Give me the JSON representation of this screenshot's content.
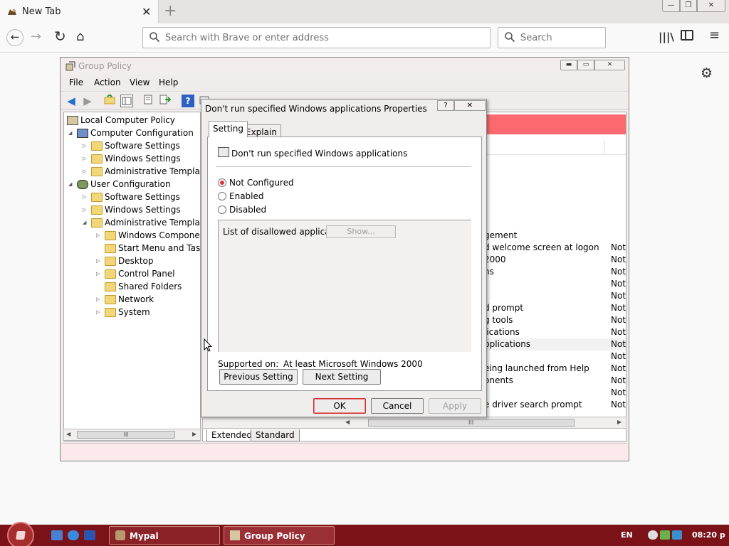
{
  "browser": {
    "tab_title": "New Tab",
    "tab_close": "✕",
    "new_tab": "+",
    "window_buttons": {
      "minimize": "—",
      "maximize": "❐",
      "close": "✕"
    },
    "nav": {
      "back": "←",
      "forward": "→",
      "reload": "↻",
      "home": "⌂"
    },
    "urlbar_placeholder": "Search with Brave or enter address",
    "searchbar_placeholder": "Search",
    "toolbar": {
      "library": "|||\\",
      "menu": "≡",
      "gear": "⚙"
    }
  },
  "gp_window": {
    "title": "Group Policy",
    "window_buttons": {
      "minimize": "▬",
      "maximize": "▭",
      "close": "✕"
    },
    "menu": [
      "File",
      "Action",
      "View",
      "Help"
    ],
    "toolbar_icons": [
      "back-icon",
      "forward-icon",
      "up-folder-icon",
      "show-hide-tree-icon",
      "properties-icon",
      "export-list-icon",
      "help-icon",
      "console-icon"
    ],
    "tree": [
      {
        "label": "Local Computer Policy",
        "level": 0,
        "expander": "",
        "icon": "policy-icon"
      },
      {
        "label": "Computer Configuration",
        "level": 1,
        "expander": "◢",
        "icon": "computer-icon"
      },
      {
        "label": "Software Settings",
        "level": 2,
        "expander": "▷",
        "icon": "folder-icon"
      },
      {
        "label": "Windows Settings",
        "level": 2,
        "expander": "▷",
        "icon": "folder-icon"
      },
      {
        "label": "Administrative Templates",
        "level": 2,
        "expander": "▷",
        "icon": "folder-icon"
      },
      {
        "label": "User Configuration",
        "level": 1,
        "expander": "◢",
        "icon": "user-icon"
      },
      {
        "label": "Software Settings",
        "level": 2,
        "expander": "▷",
        "icon": "folder-icon"
      },
      {
        "label": "Windows Settings",
        "level": 2,
        "expander": "▷",
        "icon": "folder-icon"
      },
      {
        "label": "Administrative Templates",
        "level": 2,
        "expander": "◢",
        "icon": "folder-icon"
      },
      {
        "label": "Windows Components",
        "level": 3,
        "expander": "▷",
        "icon": "folder-icon"
      },
      {
        "label": "Start Menu and Taskbar",
        "level": 3,
        "expander": "",
        "icon": "folder-icon"
      },
      {
        "label": "Desktop",
        "level": 3,
        "expander": "▷",
        "icon": "folder-icon"
      },
      {
        "label": "Control Panel",
        "level": 3,
        "expander": "▷",
        "icon": "folder-icon"
      },
      {
        "label": "Shared Folders",
        "level": 3,
        "expander": "",
        "icon": "folder-icon"
      },
      {
        "label": "Network",
        "level": 3,
        "expander": "▷",
        "icon": "folder-icon"
      },
      {
        "label": "System",
        "level": 3,
        "expander": "▷",
        "icon": "folder-icon"
      }
    ],
    "list": [
      {
        "setting": "gement",
        "state": ""
      },
      {
        "setting": "d welcome screen at logon",
        "state": "Not"
      },
      {
        "setting": "2000",
        "state": "Not"
      },
      {
        "setting": "ns",
        "state": "Not"
      },
      {
        "setting": "",
        "state": "Not"
      },
      {
        "setting": "",
        "state": "Not"
      },
      {
        "setting": "d prompt",
        "state": "Not"
      },
      {
        "setting": "g tools",
        "state": "Not"
      },
      {
        "setting": "lications",
        "state": "Not"
      },
      {
        "setting": "pplications",
        "state": "Not"
      },
      {
        "setting": "",
        "state": "Not"
      },
      {
        "setting": "eing launched from Help",
        "state": "Not"
      },
      {
        "setting": "onents",
        "state": "Not"
      },
      {
        "setting": "",
        "state": "Not"
      },
      {
        "setting": "e driver search prompt",
        "state": "Not"
      }
    ],
    "bottom_tabs": [
      "Extended",
      "Standard"
    ],
    "scrollbar_grip": "III"
  },
  "dialog": {
    "title": "Don't run specified Windows applications Properties",
    "help_button": "?",
    "close_button": "✕",
    "tabs": [
      "Setting",
      "Explain"
    ],
    "policy_name": "Don't run specified Windows applications",
    "options": [
      {
        "label": "Not Configured",
        "checked": true
      },
      {
        "label": "Enabled",
        "checked": false
      },
      {
        "label": "Disabled",
        "checked": false
      }
    ],
    "options_label": "List of disallowed applications",
    "show_button": "Show...",
    "supported_label": "Supported on:",
    "supported_value": "At least Microsoft Windows 2000",
    "previous_button": "Previous Setting",
    "next_button": "Next Setting",
    "ok_button": "OK",
    "cancel_button": "Cancel",
    "apply_button": "Apply"
  },
  "taskbar": {
    "tasks": [
      {
        "label": "Mypal",
        "icon": "mypal-icon"
      },
      {
        "label": "Group Policy",
        "icon": "group-policy-icon"
      }
    ],
    "lang": "EN",
    "clock": "08:20 p"
  }
}
